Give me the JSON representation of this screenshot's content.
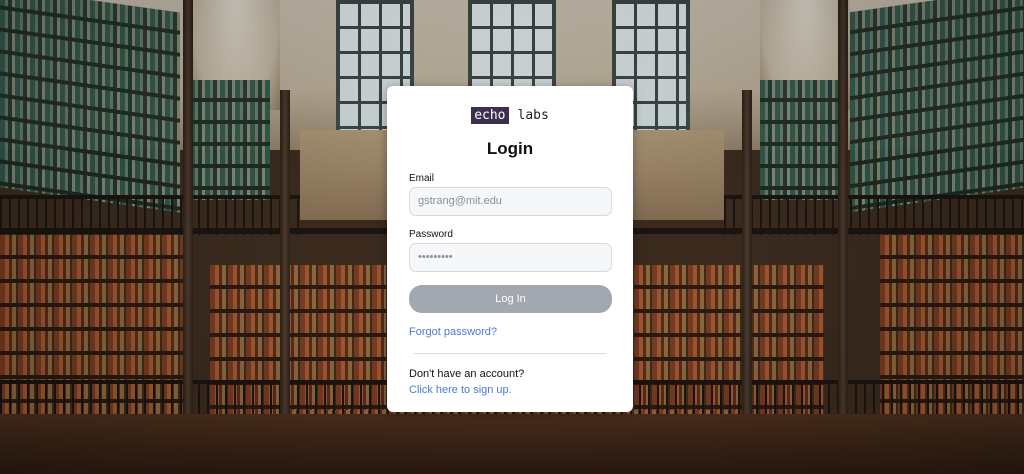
{
  "logo": {
    "part1": "echo",
    "part2": "labs",
    "accent_color": "#3d2f4e"
  },
  "form": {
    "title": "Login",
    "email_label": "Email",
    "email_value": "gstrang@mit.edu",
    "password_label": "Password",
    "password_value": "•••••••••",
    "login_button": "Log In",
    "forgot_link": "Forgot password?",
    "no_account_text": "Don't have an account?",
    "signup_link": "Click here to sign up."
  },
  "colors": {
    "button_bg": "#a2a7b0",
    "link": "#4a7bd0"
  }
}
